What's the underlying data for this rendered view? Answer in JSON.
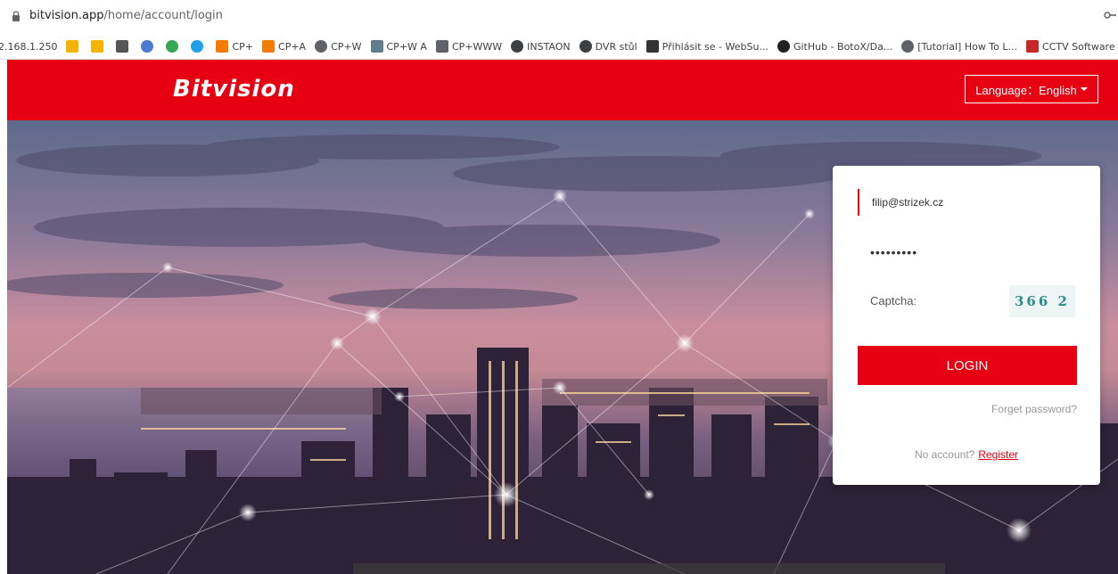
{
  "browser": {
    "url_domain": "bitvision.app",
    "url_path": "/home/account/login",
    "bookmarks": [
      {
        "label": "2.168.1.250",
        "icon": "none",
        "color": ""
      },
      {
        "label": "",
        "icon": "shopping-bag-icon",
        "color": "#f4b400"
      },
      {
        "label": "",
        "icon": "flag-icon",
        "color": "#f4b400"
      },
      {
        "label": "",
        "icon": "letter-icon",
        "color": "#555555"
      },
      {
        "label": "",
        "icon": "circle-icon",
        "color": "#4a7bd0"
      },
      {
        "label": "",
        "icon": "cloud-icon",
        "color": "#34a853"
      },
      {
        "label": "",
        "icon": "blue-dot-icon",
        "color": "#1ea0e8"
      },
      {
        "label": "CP+",
        "icon": "cp-icon",
        "color": "#f57c00"
      },
      {
        "label": "CP+A",
        "icon": "cp-icon",
        "color": "#f57c00"
      },
      {
        "label": "CP+W",
        "icon": "globe-icon",
        "color": "#5f6368"
      },
      {
        "label": "CP+W A",
        "icon": "image-icon",
        "color": "#607d8b"
      },
      {
        "label": "CP+WWW",
        "icon": "x-icon",
        "color": "#5f6368"
      },
      {
        "label": "INSTAON",
        "icon": "e-icon",
        "color": "#3c4043"
      },
      {
        "label": "DVR stůl",
        "icon": "e-icon",
        "color": "#3c4043"
      },
      {
        "label": "Přihlásit se - WebSu...",
        "icon": "web-icon",
        "color": "#333333"
      },
      {
        "label": "GitHub - BotoX/Da...",
        "icon": "github-icon",
        "color": "#202124"
      },
      {
        "label": "[Tutorial] How To L...",
        "icon": "globe-icon",
        "color": "#5f6368"
      },
      {
        "label": "CCTV Software - Ba...",
        "icon": "cctv-icon",
        "color": "#c62828"
      }
    ]
  },
  "header": {
    "logo": "Bitvision",
    "language_label": "Language：English"
  },
  "login": {
    "email_value": "filip@strizek.cz",
    "password_value": "•••••••••",
    "captcha_label": "Captcha:",
    "captcha_text": "366 2",
    "login_label": "LOGIN",
    "forget_label": "Forget password?",
    "no_account_label": "No account?",
    "register_label": "Register"
  },
  "colors": {
    "brand_red": "#e60012"
  }
}
